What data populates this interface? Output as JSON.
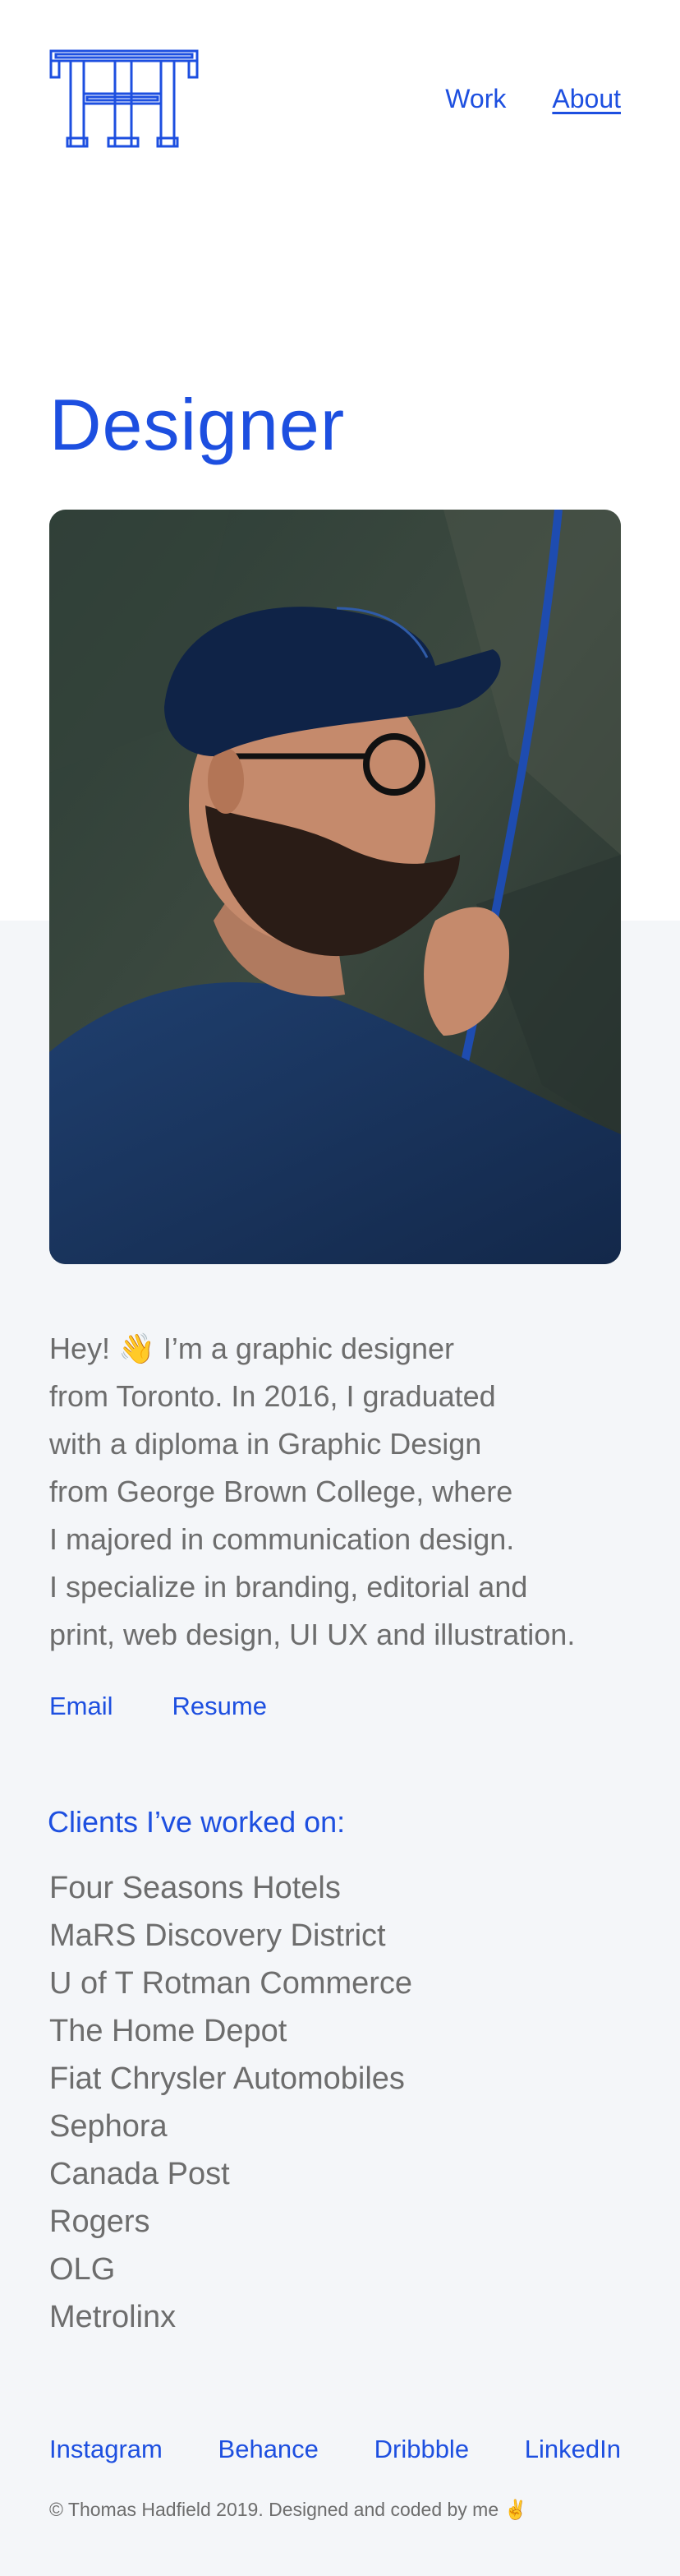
{
  "nav": {
    "work_label": "Work",
    "about_label": "About"
  },
  "page": {
    "title": "Designer"
  },
  "bio": {
    "lines": [
      "Hey! 👋  I’m a graphic designer",
      "from Toronto. In 2016, I graduated",
      "with a diploma in Graphic Design",
      "from George Brown College, where",
      "I majored in communication design.",
      "I specialize in branding, editorial and",
      "print, web design, UI UX and illustration."
    ]
  },
  "contact": {
    "email_label": "Email",
    "resume_label": "Resume"
  },
  "clients": {
    "heading": "Clients I’ve worked on:",
    "items": [
      "Four Seasons Hotels",
      "MaRS Discovery District",
      "U of T Rotman Commerce",
      "The Home Depot",
      "Fiat Chrysler Automobiles",
      "Sephora",
      "Canada Post",
      "Rogers",
      "OLG",
      "Metrolinx"
    ]
  },
  "social": {
    "instagram_label": "Instagram",
    "behance_label": "Behance",
    "dribbble_label": "Dribbble",
    "linkedin_label": "LinkedIn"
  },
  "footer": {
    "note": "© Thomas Hadfield 2019. Designed and coded by me ✌️"
  },
  "colors": {
    "accent": "#1d4fe0",
    "body_text": "#6d6d6d",
    "lower_background": "#f4f6f9"
  },
  "icons": {
    "logo": "th-monogram-logo"
  }
}
